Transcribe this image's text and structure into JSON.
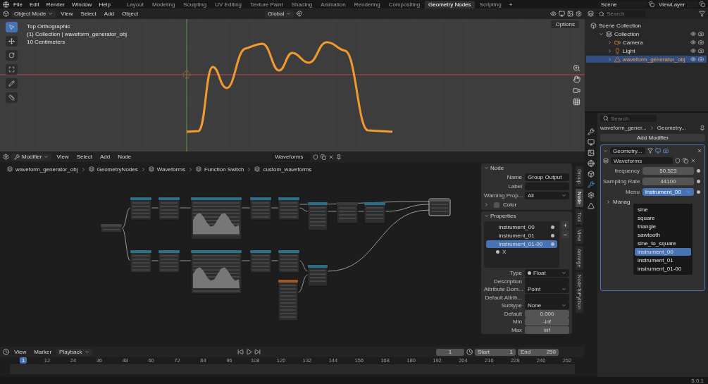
{
  "top_bar": {
    "menus": [
      "File",
      "Edit",
      "Render",
      "Window",
      "Help"
    ],
    "workspaces": [
      {
        "label": "Layout",
        "selected": false
      },
      {
        "label": "Modeling",
        "selected": false
      },
      {
        "label": "Sculpting",
        "selected": false
      },
      {
        "label": "UV Editing",
        "selected": false
      },
      {
        "label": "Texture Paint",
        "selected": false
      },
      {
        "label": "Shading",
        "selected": false
      },
      {
        "label": "Animation",
        "selected": false
      },
      {
        "label": "Rendering",
        "selected": false
      },
      {
        "label": "Compositing",
        "selected": false
      },
      {
        "label": "Geometry Nodes",
        "selected": true
      },
      {
        "label": "Scripting",
        "selected": false
      }
    ],
    "add_workspace": "+",
    "scene": "Scene",
    "view_layer": "ViewLayer"
  },
  "viewport": {
    "mode": "Object Mode",
    "menus": [
      "View",
      "Select",
      "Add",
      "Object"
    ],
    "orientation": "Global",
    "overlay_lines": [
      "Top Orthographic",
      "(1) Collection | waveform_generator_obj",
      "10 Centimeters"
    ],
    "options": "Options"
  },
  "outliner": {
    "search_placeholder": "Search",
    "tree": [
      {
        "label": "Scene Collection",
        "kind": "scene",
        "selected": false,
        "children": [
          {
            "label": "Collection",
            "kind": "collection",
            "selected": false,
            "children": [
              {
                "label": "Camera",
                "kind": "camera",
                "selected": false
              },
              {
                "label": "Light",
                "kind": "light",
                "selected": false
              },
              {
                "label": "waveform_generator_obj",
                "kind": "mesh",
                "selected": true
              }
            ]
          }
        ]
      }
    ]
  },
  "node_editor": {
    "editor": "Modifier",
    "menus": [
      "View",
      "Select",
      "Add",
      "Node"
    ],
    "tree_name": "Waveforms",
    "breadcrumbs": [
      "waveform_generator_obj",
      "GeometryNodes",
      "Waveforms",
      "Function Switch",
      "custom_waveforms"
    ],
    "sidebar_tabs": [
      {
        "label": "Group",
        "selected": false
      },
      {
        "label": "Node",
        "selected": true
      },
      {
        "label": "Tool",
        "selected": false
      },
      {
        "label": "View",
        "selected": false
      },
      {
        "label": "Arrange",
        "selected": false
      },
      {
        "label": "NodeToPython",
        "selected": false
      }
    ],
    "node_panel": {
      "title": "Node",
      "rows": [
        {
          "label": "Name",
          "value": "Group Output",
          "kind": "text"
        },
        {
          "label": "Label",
          "kind": "text"
        },
        {
          "label": "Warning Prop...",
          "value": "All",
          "kind": "dropdown"
        }
      ],
      "color_label": "Color",
      "color_enabled": false
    },
    "properties_panel": {
      "title": "Properties",
      "items": [
        {
          "label": "instrument_00",
          "selected": false
        },
        {
          "label": "instrument_01",
          "selected": false
        },
        {
          "label": "instrument_01-00",
          "selected": true
        }
      ],
      "socket": "X",
      "add": "+",
      "remove": "−",
      "fields": [
        {
          "label": "Type",
          "value": "Float",
          "kind": "socket"
        },
        {
          "label": "Description",
          "kind": "text"
        },
        {
          "label": "Attribute Dom...",
          "value": "Point",
          "kind": "dropdown"
        },
        {
          "label": "Default Attrib...",
          "kind": "text"
        },
        {
          "label": "Subtype",
          "value": "None",
          "kind": "dropdown"
        },
        {
          "label": "Default",
          "value": "0.000",
          "kind": "number"
        },
        {
          "label": "Min",
          "value": "-inf",
          "kind": "number"
        },
        {
          "label": "Max",
          "value": "inf",
          "kind": "number"
        }
      ]
    }
  },
  "properties": {
    "search_placeholder": "Search",
    "breadcrumbs": [
      "waveform_gener...",
      "Geometry..."
    ],
    "add_modifier": "Add Modifier",
    "modifier_name": "Geometry...",
    "tree_name": "Waveforms",
    "inputs": [
      {
        "label": "frequency",
        "value": "50.523",
        "kind": "number"
      },
      {
        "label": "Sampling Rate",
        "value": "44100",
        "kind": "number"
      },
      {
        "label": "Menu",
        "value": "instrument_00",
        "kind": "menu"
      }
    ],
    "manage": "Manag",
    "menu_options": [
      {
        "label": "sine",
        "selected": false
      },
      {
        "label": "square",
        "selected": false
      },
      {
        "label": "triangle",
        "selected": false
      },
      {
        "label": "sawtooth",
        "selected": false
      },
      {
        "label": "sine_to_square",
        "selected": false
      },
      {
        "label": "instrument_00",
        "selected": true
      },
      {
        "label": "instrument_01",
        "selected": false
      },
      {
        "label": "instrument_01-00",
        "selected": false
      }
    ]
  },
  "timeline": {
    "menus": [
      "View",
      "Marker"
    ],
    "playback": "Playback",
    "current_frame": "1",
    "start_label": "Start",
    "start": "1",
    "end_label": "End",
    "end": "250",
    "playhead": "1",
    "ruler": [
      "12",
      "24",
      "36",
      "48",
      "60",
      "72",
      "84",
      "96",
      "108",
      "120",
      "132",
      "144",
      "156",
      "168",
      "180",
      "192",
      "204",
      "216",
      "228",
      "240",
      "252"
    ]
  },
  "status_bar": {
    "version": "5.0.1"
  }
}
